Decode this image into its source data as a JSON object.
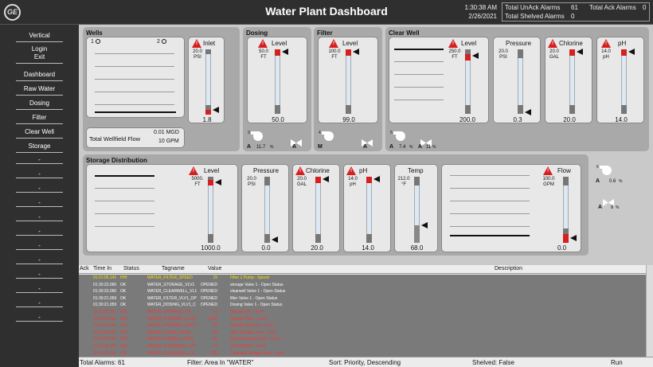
{
  "header": {
    "title": "Water Plant Dashboard",
    "time": "1:30:38 AM",
    "date": "2/26/2021",
    "logo": "GE",
    "unack_label": "Total UnAck Alarms",
    "unack_value": "61",
    "ack_label": "Total Ack Alarms",
    "ack_value": "0",
    "shelved_label": "Total Shelved Alarms",
    "shelved_value": "0"
  },
  "nav": {
    "items": [
      "Vertical",
      "Login",
      "Exit",
      "Dashboard",
      "Raw Water",
      "Dosing",
      "Filter",
      "Clear Well",
      "Storage"
    ],
    "placeholders": [
      "-",
      "-",
      "-",
      "-",
      "-",
      "-",
      "-",
      "-",
      "-",
      "-",
      "-",
      "-"
    ]
  },
  "wells": {
    "title": "Wells",
    "well1": "1",
    "well2": "2",
    "inlet_label": "Inlet",
    "inlet_sp": "20.0",
    "inlet_unit": "PSI",
    "inlet_value": "1.8",
    "flow_label": "Total Wellfield Flow",
    "flow_mgd": "0.01 MGD",
    "flow_gpm": "10 GPM"
  },
  "dosing": {
    "title": "Dosing",
    "level_label": "Level",
    "sp": "50.0",
    "unit": "FT",
    "value": "50.0",
    "pump_num": "3",
    "pump_mode": "A",
    "pump_speed": "11.7",
    "pct": "%",
    "valve_mode": "A"
  },
  "filter": {
    "title": "Filter",
    "level_label": "Level",
    "sp": "100.0",
    "unit": "FT",
    "value": "99.0",
    "pump_num": "4",
    "pump_mode": "M",
    "valve_mode": "A"
  },
  "clearwell": {
    "title": "Clear Well",
    "level_label": "Level",
    "level_sp": "250.0",
    "level_unit": "FT",
    "level_value": "200.0",
    "pressure_label": "Pressure",
    "pressure_sp": "20.0",
    "pressure_unit": "PSI",
    "pressure_value": "0.3",
    "chlorine_label": "Chlorine",
    "chlorine_sp": "20.0",
    "chlorine_unit": "GAL",
    "chlorine_value": "20.0",
    "ph_label": "pH",
    "ph_sp": "14.0",
    "ph_unit": "pH",
    "ph_value": "14.0",
    "pump_num": "5",
    "pump_mode": "A",
    "pump_speed": "7.4",
    "pct": "%",
    "valve_mode": "A",
    "valve_pct": "11"
  },
  "storage": {
    "title": "Storage Distribution",
    "level_label": "Level",
    "level_sp": "5000.",
    "level_unit": "FT",
    "level_value": "1000.0",
    "pressure_label": "Pressure",
    "pressure_sp": "20.0",
    "pressure_unit": "PSI",
    "pressure_value": "0.0",
    "chlorine_label": "Chlorine",
    "chlorine_sp": "20.0",
    "chlorine_unit": "GAL",
    "chlorine_value": "20.0",
    "ph_label": "pH",
    "ph_sp": "14.0",
    "ph_unit": "pH",
    "ph_value": "14.0",
    "temp_label": "Temp",
    "temp_sp": "212.0",
    "temp_unit": "°F",
    "temp_value": "68.0",
    "flow_label": "Flow",
    "flow_sp": "100.0",
    "flow_unit": "GPM",
    "flow_value": "0.0",
    "pump_num": "6",
    "pump_mode": "A",
    "pump_speed": "0.6",
    "pct": "%",
    "valve_mode": "A",
    "valve_pct": "8"
  },
  "alarms": {
    "columns": [
      "Ack",
      "Time In",
      "Status",
      "Tagname",
      "Value",
      "Description"
    ],
    "rows": [
      {
        "time": "01:21:05.141",
        "status": "HHI",
        "tag": "WATER_FILTER_SPEED",
        "value": "15",
        "desc": "Filter 1 Pump - Speed",
        "color": "#f2e600"
      },
      {
        "time": "01:30:23.060",
        "status": "OK",
        "tag": "WATER_STORAGE_VLV1",
        "value": "OPENED",
        "desc": "storage Valve 1 - Open Status",
        "color": "#ffffff"
      },
      {
        "time": "01:30:23.060",
        "status": "OK",
        "tag": "WATER_CLEARWELL_VL1",
        "value": "OPENED",
        "desc": "clearwell Valve 1 - Open Status",
        "color": "#ffffff"
      },
      {
        "time": "01:30:21.059",
        "status": "OK",
        "tag": "WATER_FILTER_VLV1_OP",
        "value": "OPENED",
        "desc": "filter Valve 1 - Open Status",
        "color": "#ffffff"
      },
      {
        "time": "01:30:21.059",
        "status": "OK",
        "tag": "WATER_DOSING_VLV1_C",
        "value": "OPENED",
        "desc": "Dosing Valve 1 - Open Status",
        "color": "#ffffff"
      },
      {
        "time": "01:21:05.141",
        "status": "HHI",
        "tag": "WATER_STORAGE_PH",
        "value": "14",
        "desc": "Storage pH - Level",
        "color": "#ff3333"
      },
      {
        "time": "01:21:05.141",
        "status": "HHI",
        "tag": "WATER_STORAGE_LEVE",
        "value": "1,000",
        "desc": "Storage Tank - Level",
        "color": "#ff3333"
      },
      {
        "time": "01:21:05.141",
        "status": "HHI",
        "tag": "WATER_STORAGE_CHLO",
        "value": "20",
        "desc": "Storage Chlorine - Level",
        "color": "#ff3333"
      },
      {
        "time": "01:21:05.141",
        "status": "HHI",
        "tag": "WATER_FILTER_LEVEL",
        "value": "99",
        "desc": "Filter Storage Tank - Level",
        "color": "#ff3333"
      },
      {
        "time": "01:21:05.141",
        "status": "HHI",
        "tag": "WATER_DOSING_LEVEL",
        "value": "50",
        "desc": "Dosing Storage Tank - Level",
        "color": "#ff3333"
      },
      {
        "time": "01:21:05.141",
        "status": "HHI",
        "tag": "WATER_CLEARWELL_PH",
        "value": "14",
        "desc": "Clearwell pH - Level",
        "color": "#ff3333"
      },
      {
        "time": "01:21:05.141",
        "status": "HHI",
        "tag": "WATER_CLEARWELL_LE",
        "value": "200",
        "desc": "Clearwell Storage Tank - Level",
        "color": "#ff3333"
      }
    ]
  },
  "statusbar": {
    "total": "Total Alarms: 61",
    "filter": "Filter: Area In \"WATER\"",
    "sort": "Sort: Priority, Descending",
    "shelved": "Shelved: False",
    "run": "Run"
  }
}
